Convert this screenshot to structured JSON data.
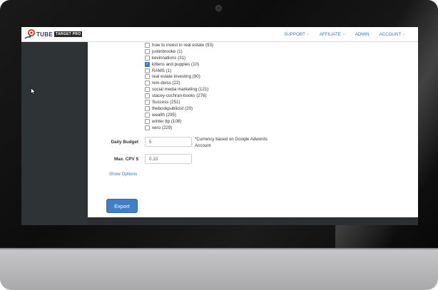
{
  "nav": {
    "logo_main": "TUBE",
    "logo_sub": "TARGET PRO",
    "items": [
      {
        "label": "SUPPORT",
        "dropdown": true
      },
      {
        "label": "AFFILIATE",
        "dropdown": true
      },
      {
        "label": "ADMIN",
        "dropdown": false
      },
      {
        "label": "ACCOUNT",
        "dropdown": true
      }
    ]
  },
  "keywords": [
    {
      "label": "how to invest in real estate (93)",
      "checked": false
    },
    {
      "label": "justinbrooke (1)",
      "checked": false
    },
    {
      "label": "kevinnations (31)",
      "checked": false
    },
    {
      "label": "kittens and puppies (10)",
      "checked": true
    },
    {
      "label": "RAMS (1)",
      "checked": false
    },
    {
      "label": "real estate investing (90)",
      "checked": false
    },
    {
      "label": "rein-deiss (22)",
      "checked": false
    },
    {
      "label": "social media marketing (121)",
      "checked": false
    },
    {
      "label": "stacey-cochran-books (276)",
      "checked": false
    },
    {
      "label": "Success (251)",
      "checked": false
    },
    {
      "label": "thebookpublicist (20)",
      "checked": false
    },
    {
      "label": "wealth (295)",
      "checked": false
    },
    {
      "label": "winter ttp (108)",
      "checked": false
    },
    {
      "label": "xero (229)",
      "checked": false
    }
  ],
  "form": {
    "daily_budget_label": "Daily Budget",
    "daily_budget_value": "5",
    "currency_note": "*Currency based on Google Adwords Account",
    "max_cpv_label": "Max. CPV $",
    "max_cpv_value": "0.10",
    "show_options": "Show Options",
    "export_label": "Export"
  },
  "colors": {
    "accent": "#337ab7",
    "button": "#3f7fc7",
    "sidebar": "#2e3436"
  }
}
